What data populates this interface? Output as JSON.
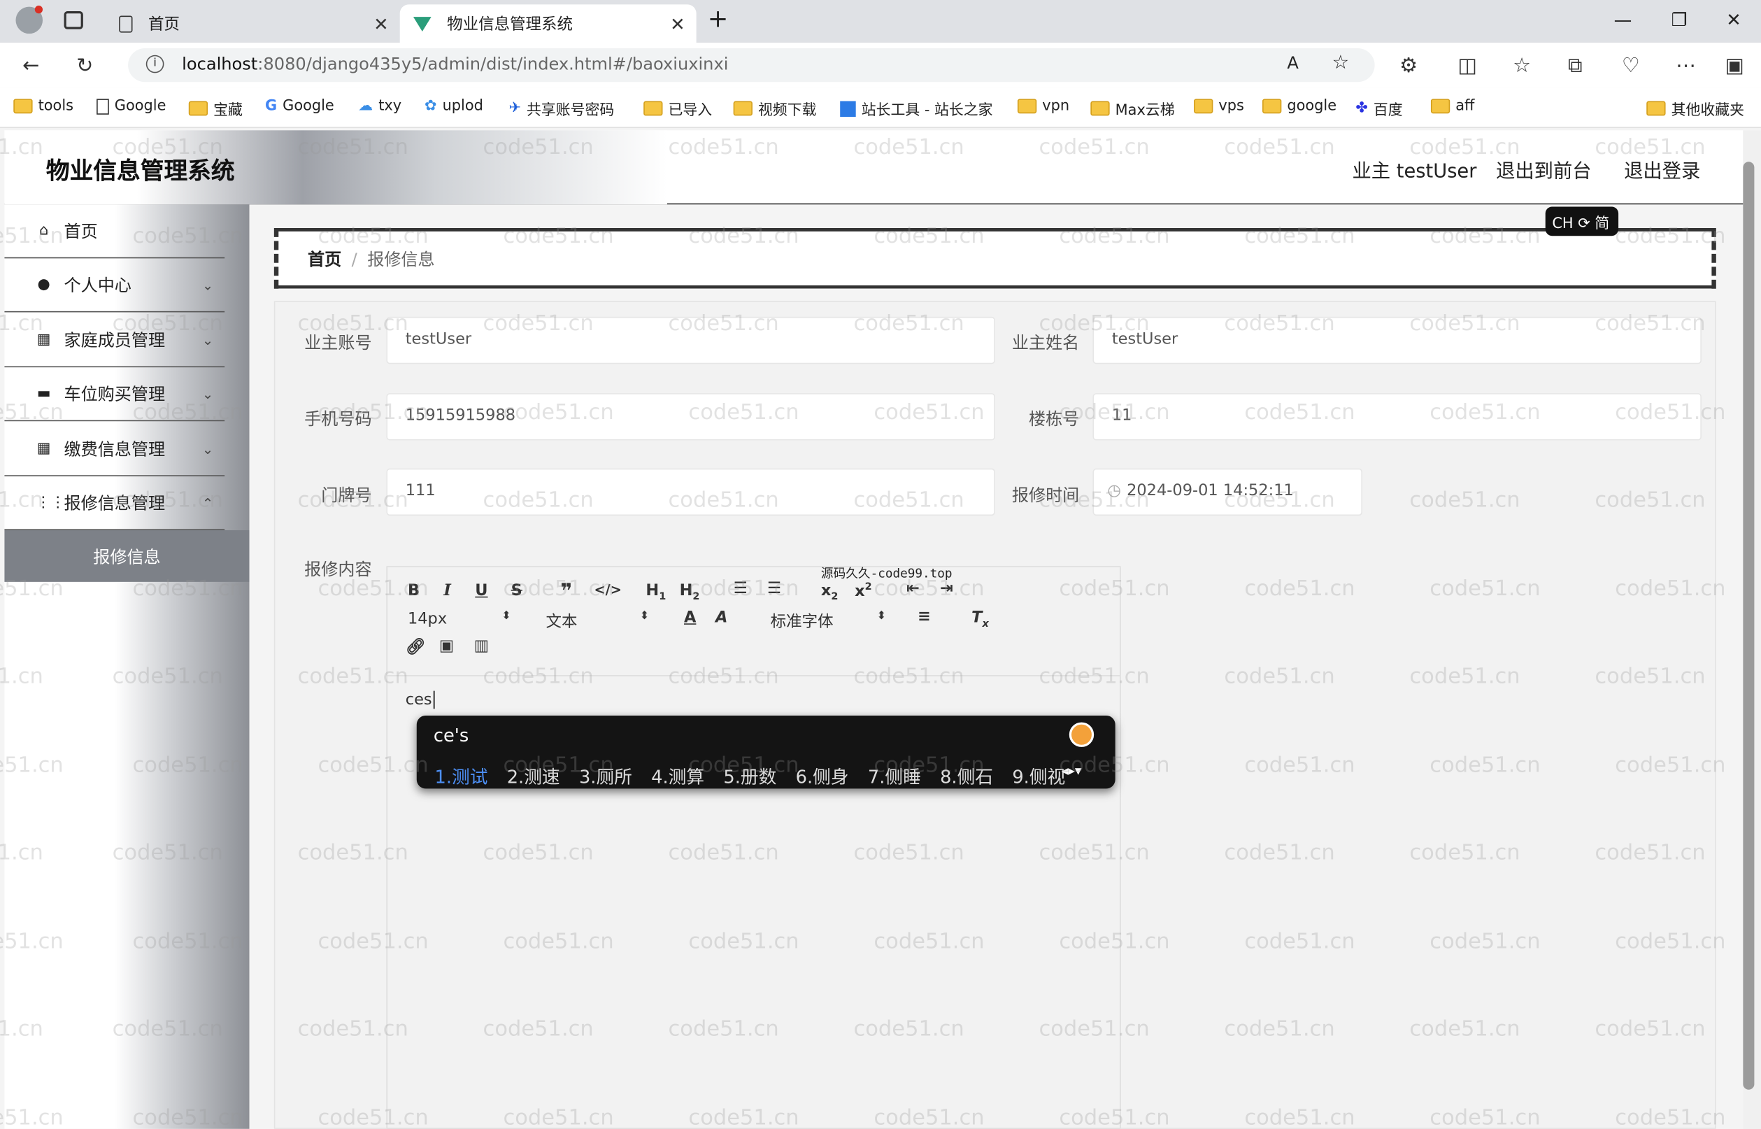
{
  "browser": {
    "tabs": [
      {
        "label": "首页"
      },
      {
        "label": "物业信息管理系统"
      }
    ],
    "url_host": "localhost",
    "url_rest": ":8080/django435y5/admin/dist/index.html#/baoxiuxinxi",
    "bookmarks": [
      "tools",
      "Google",
      "宝藏",
      "Google",
      "txy",
      "uplod",
      "共享账号密码",
      "已导入",
      "视频下载",
      "站长工具 - 站长之家",
      "vpn",
      "Max云梯",
      "vps",
      "google",
      "百度",
      "aff"
    ],
    "other_bookmarks": "其他收藏夹"
  },
  "header": {
    "title": "物业信息管理系统",
    "user": "业主 testUser",
    "to_front": "退出到前台",
    "logout": "退出登录"
  },
  "sidebar": {
    "items": [
      {
        "label": "首页",
        "icon": "home-icon"
      },
      {
        "label": "个人中心",
        "icon": "user-icon"
      },
      {
        "label": "家庭成员管理",
        "icon": "grid-icon"
      },
      {
        "label": "车位购买管理",
        "icon": "briefcase-icon"
      },
      {
        "label": "缴费信息管理",
        "icon": "grid-icon"
      },
      {
        "label": "报修信息管理",
        "icon": "apps-icon"
      }
    ],
    "active_sub": "报修信息"
  },
  "breadcrumb": {
    "home": "首页",
    "sep": "/",
    "current": "报修信息"
  },
  "form": {
    "owner_account_label": "业主账号",
    "owner_account": "testUser",
    "owner_name_label": "业主姓名",
    "owner_name": "testUser",
    "phone_label": "手机号码",
    "phone": "15915915988",
    "building_label": "楼栋号",
    "building": "11",
    "door_label": "门牌号",
    "door": "111",
    "time_label": "报修时间",
    "time": "2024-09-01 14:52:11",
    "content_label": "报修内容"
  },
  "editor": {
    "size": "14px",
    "block": "文本",
    "font": "标准字体",
    "content": "ces",
    "overlay_text": "源码久久-code99.top"
  },
  "ime": {
    "composition": "ce's",
    "candidates": [
      "1.测试",
      "2.测速",
      "3.厕所",
      "4.测算",
      "5.册数",
      "6.侧身",
      "7.侧睡",
      "8.侧石",
      "9.侧视"
    ],
    "indicator": "CH ⟳ 简"
  },
  "watermark": "code51.cn"
}
